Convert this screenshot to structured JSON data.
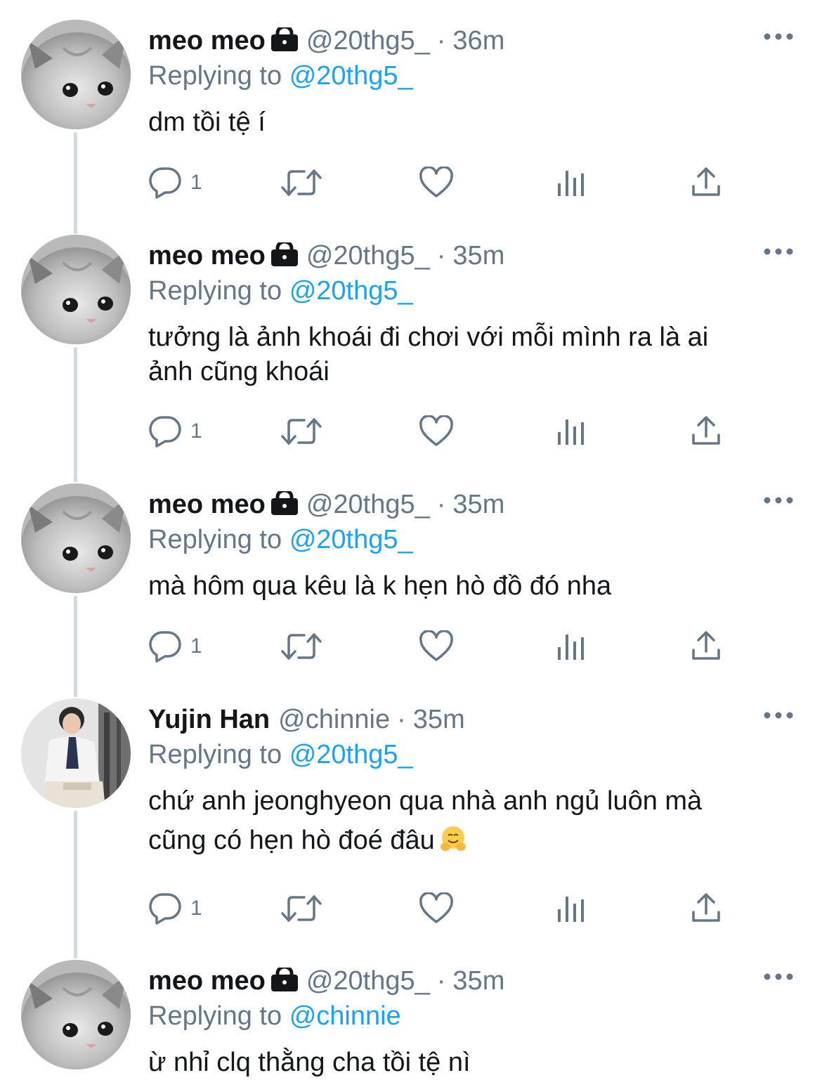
{
  "tweets": [
    {
      "name": "meo meo",
      "handle": "@20thg5_",
      "dot": "·",
      "time": "36m",
      "replying_prefix": "Replying to",
      "replying_to": "@20thg5_",
      "text": "dm tồi tệ í",
      "reply_count": "1",
      "locked": true,
      "avatar": "cat-avatar"
    },
    {
      "name": "meo meo",
      "handle": "@20thg5_",
      "dot": "·",
      "time": "35m",
      "replying_prefix": "Replying to",
      "replying_to": "@20thg5_",
      "text_lines": [
        "tưởng là ảnh khoái đi chơi với mỗi mình ra là ai",
        "ảnh cũng khoái"
      ],
      "reply_count": "1",
      "locked": true,
      "avatar": "cat-avatar"
    },
    {
      "name": "meo meo",
      "handle": "@20thg5_",
      "dot": "·",
      "time": "35m",
      "replying_prefix": "Replying to",
      "replying_to": "@20thg5_",
      "text": "mà hôm qua kêu là k hẹn hò đồ đó nha",
      "reply_count": "1",
      "locked": true,
      "avatar": "cat-avatar"
    },
    {
      "name": "Yujin Han",
      "handle": "@chinnie",
      "dot": "·",
      "time": "35m",
      "replying_prefix": "Replying to",
      "replying_to": "@20thg5_",
      "text_lines": [
        "chứ anh jeonghyeon qua nhà anh ngủ luôn mà",
        "cũng có hẹn hò đoé đâu"
      ],
      "emoji": "hugging-face-emoji",
      "reply_count": "1",
      "locked": false,
      "avatar": "person-avatar"
    },
    {
      "name": "meo meo",
      "handle": "@20thg5_",
      "dot": "·",
      "time": "35m",
      "replying_prefix": "Replying to",
      "replying_to": "@chinnie",
      "text": "ừ nhỉ clq thằng cha tồi tệ nì",
      "locked": true,
      "avatar": "cat-avatar"
    }
  ],
  "icons": {
    "reply": "reply-icon",
    "retweet": "retweet-icon",
    "like": "heart-icon",
    "views": "views-icon",
    "share": "share-icon",
    "more": "more-icon",
    "lock": "lock-icon"
  },
  "colors": {
    "link": "#1da1f2",
    "secondary": "#657786",
    "thread_line": "#cfd9de",
    "text": "#14171a"
  }
}
